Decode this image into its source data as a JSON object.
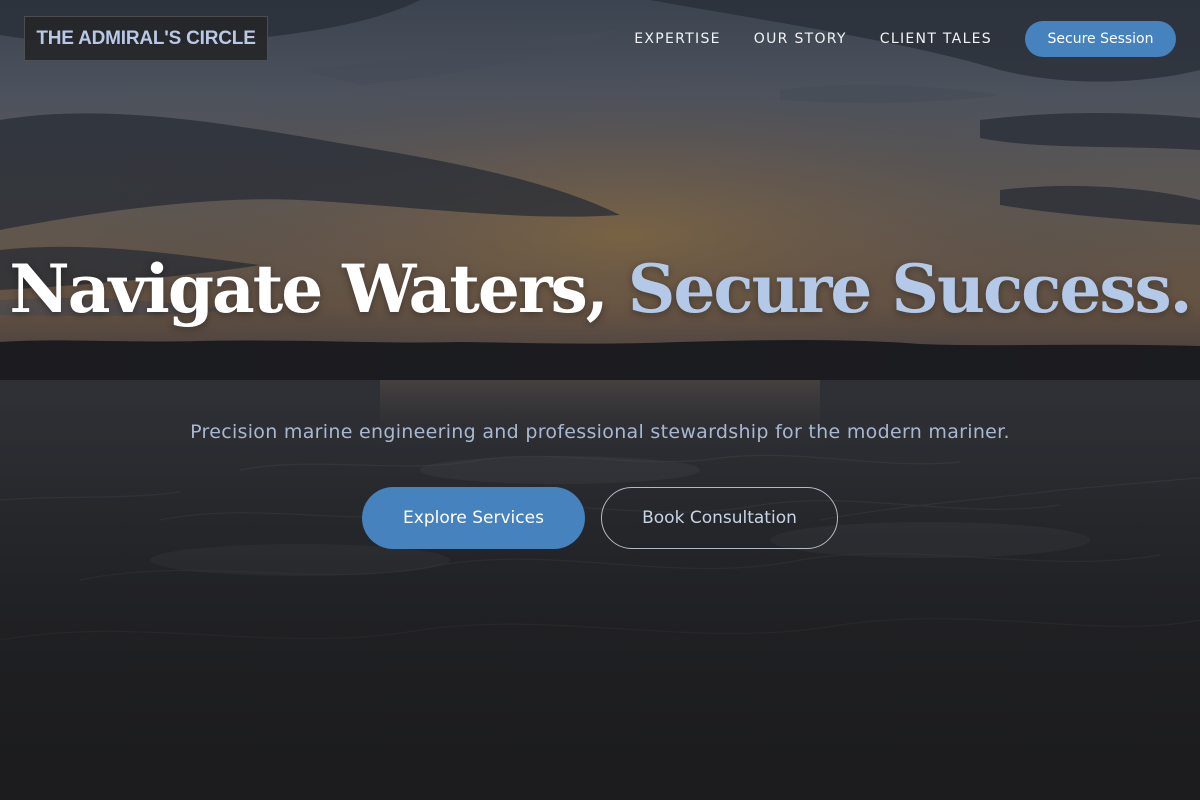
{
  "brand": {
    "logo_text": "THE ADMIRAL'S CIRCLE"
  },
  "nav": {
    "links": [
      "EXPERTISE",
      "OUR STORY",
      "CLIENT TALES"
    ],
    "cta_label": "Secure Session"
  },
  "hero": {
    "headline_lead": "Navigate Waters,",
    "headline_accent": "Secure Success.",
    "subheadline": "Precision marine engineering and professional stewardship for the modern mariner.",
    "primary_button": "Explore Services",
    "secondary_button": "Book Consultation",
    "background_description_icon": "sunset-sea-photo"
  },
  "colors": {
    "accent": "#4682be",
    "accent_text": "#b4c8e8",
    "page_bottom": "#1c1c1e"
  }
}
